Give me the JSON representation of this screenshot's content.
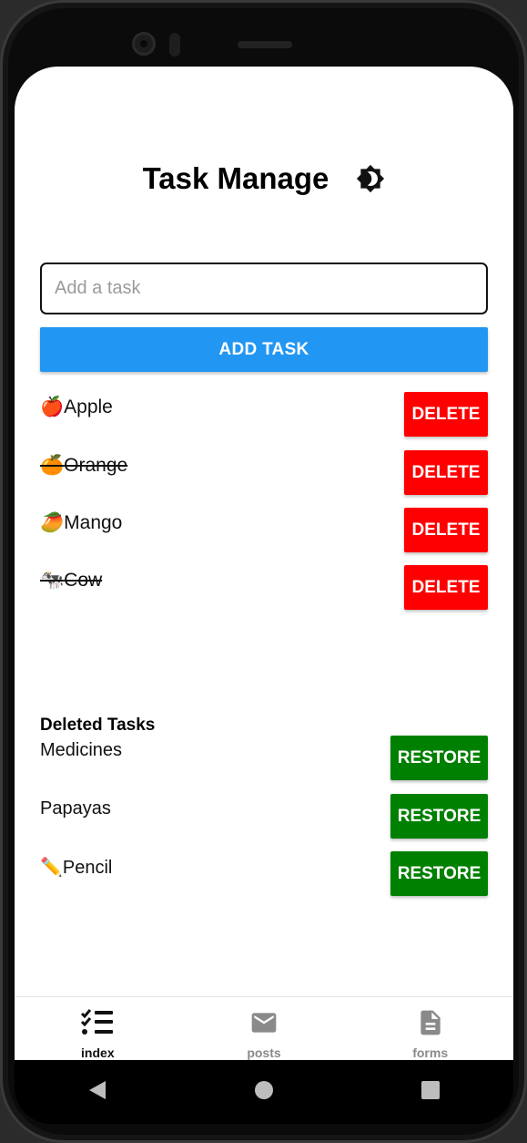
{
  "header": {
    "title": "Task Manage",
    "theme_icon": "brightness-icon"
  },
  "input": {
    "placeholder": "Add a task",
    "value": ""
  },
  "add_button_label": "ADD TASK",
  "tasks": [
    {
      "emoji": "🍎",
      "text": "Apple",
      "done": false,
      "button_label": "DELETE"
    },
    {
      "emoji": "🍊",
      "text": "Orange",
      "done": true,
      "button_label": "DELETE"
    },
    {
      "emoji": "🥭",
      "text": "Mango",
      "done": false,
      "button_label": "DELETE"
    },
    {
      "emoji": "🐄",
      "text": "Cow",
      "done": true,
      "button_label": "DELETE"
    }
  ],
  "deleted": {
    "heading": "Deleted Tasks",
    "items": [
      {
        "text": "Medicines",
        "button_label": "RESTORE"
      },
      {
        "text": "Papayas",
        "button_label": "RESTORE"
      },
      {
        "text": "✏️Pencil",
        "button_label": "RESTORE"
      }
    ]
  },
  "tabs": [
    {
      "label": "index",
      "icon": "checklist-icon",
      "active": true
    },
    {
      "label": "posts",
      "icon": "mail-icon",
      "active": false
    },
    {
      "label": "forms",
      "icon": "document-icon",
      "active": false
    }
  ],
  "colors": {
    "add": "#2196f3",
    "delete": "#ff0000",
    "restore": "#008000",
    "inactive_tab": "#8a8a8a"
  }
}
